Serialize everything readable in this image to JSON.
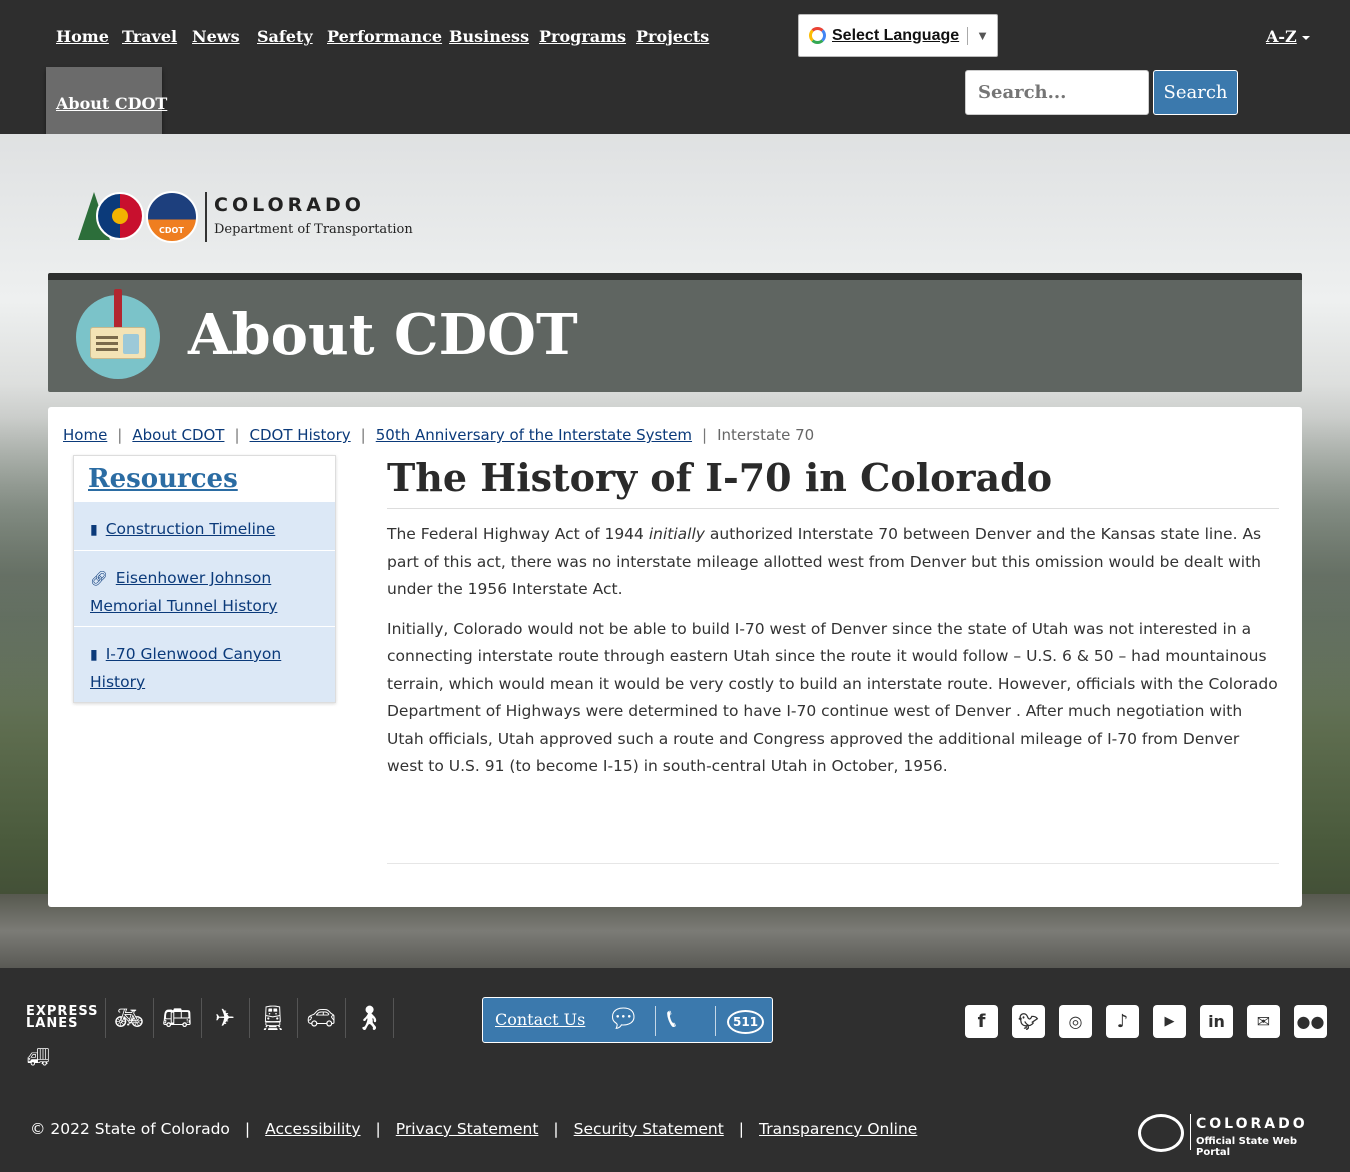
{
  "nav": {
    "items": [
      "Home",
      "Travel",
      "News",
      "Safety",
      "Performance",
      "Business",
      "Programs",
      "Projects"
    ],
    "active": "About CDOT",
    "az": "A-Z"
  },
  "translate": {
    "label": "Select Language",
    "arrow": "▼"
  },
  "search": {
    "placeholder": "Search...",
    "button": "Search"
  },
  "logo": {
    "name": "COLORADO",
    "subtitle": "Department of Transportation",
    "badge": "CDOT"
  },
  "banner": {
    "title": "About CDOT"
  },
  "breadcrumb": {
    "items": [
      "Home",
      "About CDOT",
      "CDOT History",
      "50th Anniversary of the Interstate System"
    ],
    "current": "Interstate 70"
  },
  "sidebar": {
    "title": "Resources",
    "items": [
      {
        "label": "Construction Timeline",
        "icon": "file-icon"
      },
      {
        "label": "Eisenhower Johnson Memorial Tunnel History",
        "icon": "link-icon"
      },
      {
        "label": "I-70 Glenwood Canyon History",
        "icon": "file-icon"
      }
    ]
  },
  "article": {
    "title": "The History of I-70 in Colorado",
    "p1_before": "The Federal Highway Act of 1944 ",
    "p1_em": "initially",
    "p1_after": " authorized Interstate 70 between Denver and the Kansas state line. As part of this act, there was no interstate mileage allotted west from Denver but this omission would be dealt with under the 1956 Interstate Act.",
    "p2": "Initially, Colorado would not be able to build I-70 west of Denver since the state of Utah was not interested in a connecting interstate route through eastern Utah since the route it would follow – U.S. 6 & 50 – had mountainous terrain, which would mean it would be very costly to build an interstate route. However, officials with the Colorado Department of Highways were determined to have I-70 continue west of Denver . After much negotiation with Utah officials, Utah approved such a route and Congress approved the additional mileage of I-70 from Denver west to U.S. 91 (to become I-15) in south-central Utah in October, 1956."
  },
  "footer": {
    "express_line1": "EXPRESS",
    "express_line2": "LANES",
    "contact": "Contact Us",
    "badge_511": "511",
    "social": [
      "facebook-icon",
      "twitter-icon",
      "instagram-icon",
      "tiktok-icon",
      "youtube-icon",
      "linkedin-icon",
      "email-icon",
      "flickr-icon"
    ],
    "copyright": "© 2022 State of Colorado",
    "links": [
      "Accessibility",
      "Privacy Statement",
      "Security Statement",
      "Transparency Online"
    ],
    "state_name": "COLORADO",
    "state_sub": "Official State Web Portal"
  }
}
